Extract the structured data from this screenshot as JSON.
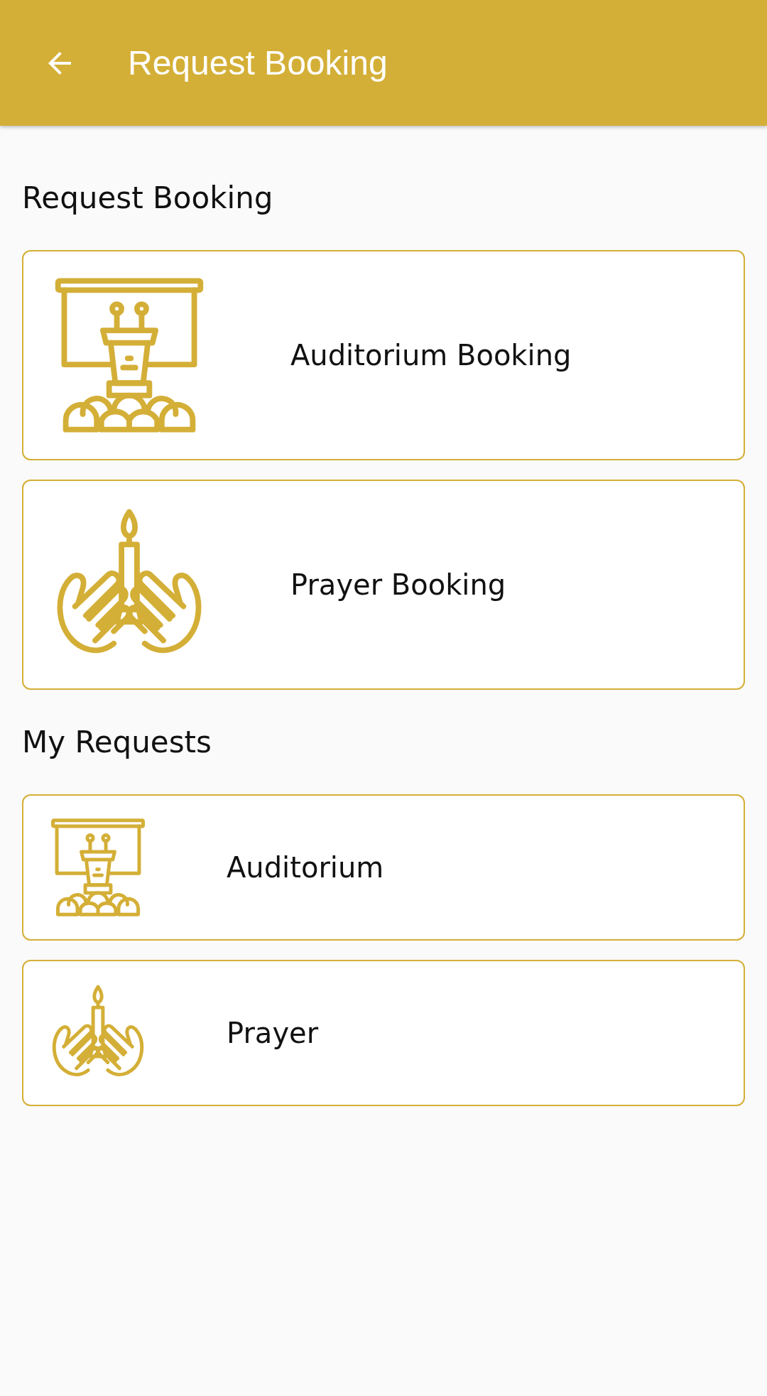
{
  "app_bar": {
    "title": "Request Booking"
  },
  "sections": [
    {
      "heading": "Request Booking",
      "kind": "large",
      "items": [
        {
          "kind": "auditorium",
          "label": "Auditorium Booking"
        },
        {
          "kind": "prayer",
          "label": "Prayer Booking"
        }
      ]
    },
    {
      "heading": "My Requests",
      "kind": "small",
      "items": [
        {
          "kind": "auditorium",
          "label": "Auditorium"
        },
        {
          "kind": "prayer",
          "label": "Prayer"
        }
      ]
    }
  ]
}
